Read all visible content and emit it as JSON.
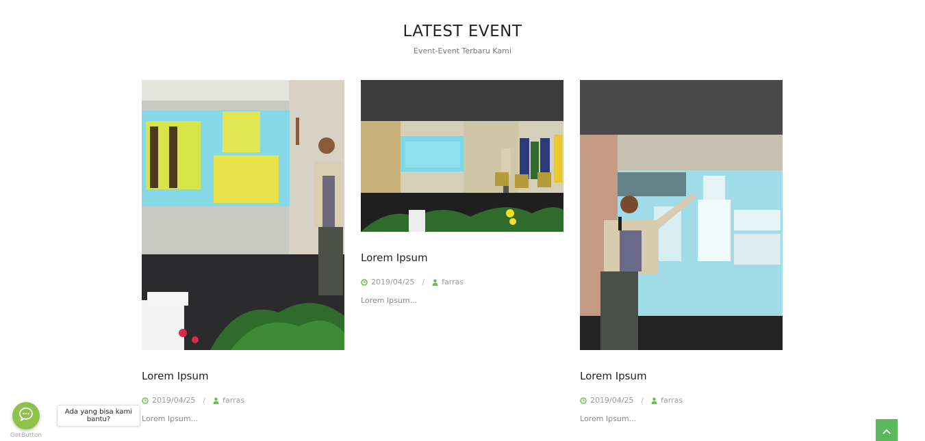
{
  "section": {
    "title": "LATEST EVENT",
    "subtitle": "Event-Event Terbaru Kami"
  },
  "events": [
    {
      "title": "Lorem Ipsum",
      "date": "2019/04/25",
      "author": "farras",
      "excerpt": "Lorem Ipsum..."
    },
    {
      "title": "Lorem Ipsum",
      "date": "2019/04/25",
      "author": "farras",
      "excerpt": "Lorem Ipsum..."
    },
    {
      "title": "Lorem Ipsum",
      "date": "2019/04/25",
      "author": "farras",
      "excerpt": "Lorem Ipsum..."
    }
  ],
  "meta_separator": "/",
  "chat_widget": {
    "tooltip": "Ada yang bisa kami bantu?",
    "brand": "GetButton",
    "icon": "whatsapp-chat-icon",
    "color": "#8ec24a"
  },
  "scroll_top": {
    "icon": "chevron-up-icon",
    "color": "#5cb85c"
  },
  "accent_color": "#6abf4b"
}
